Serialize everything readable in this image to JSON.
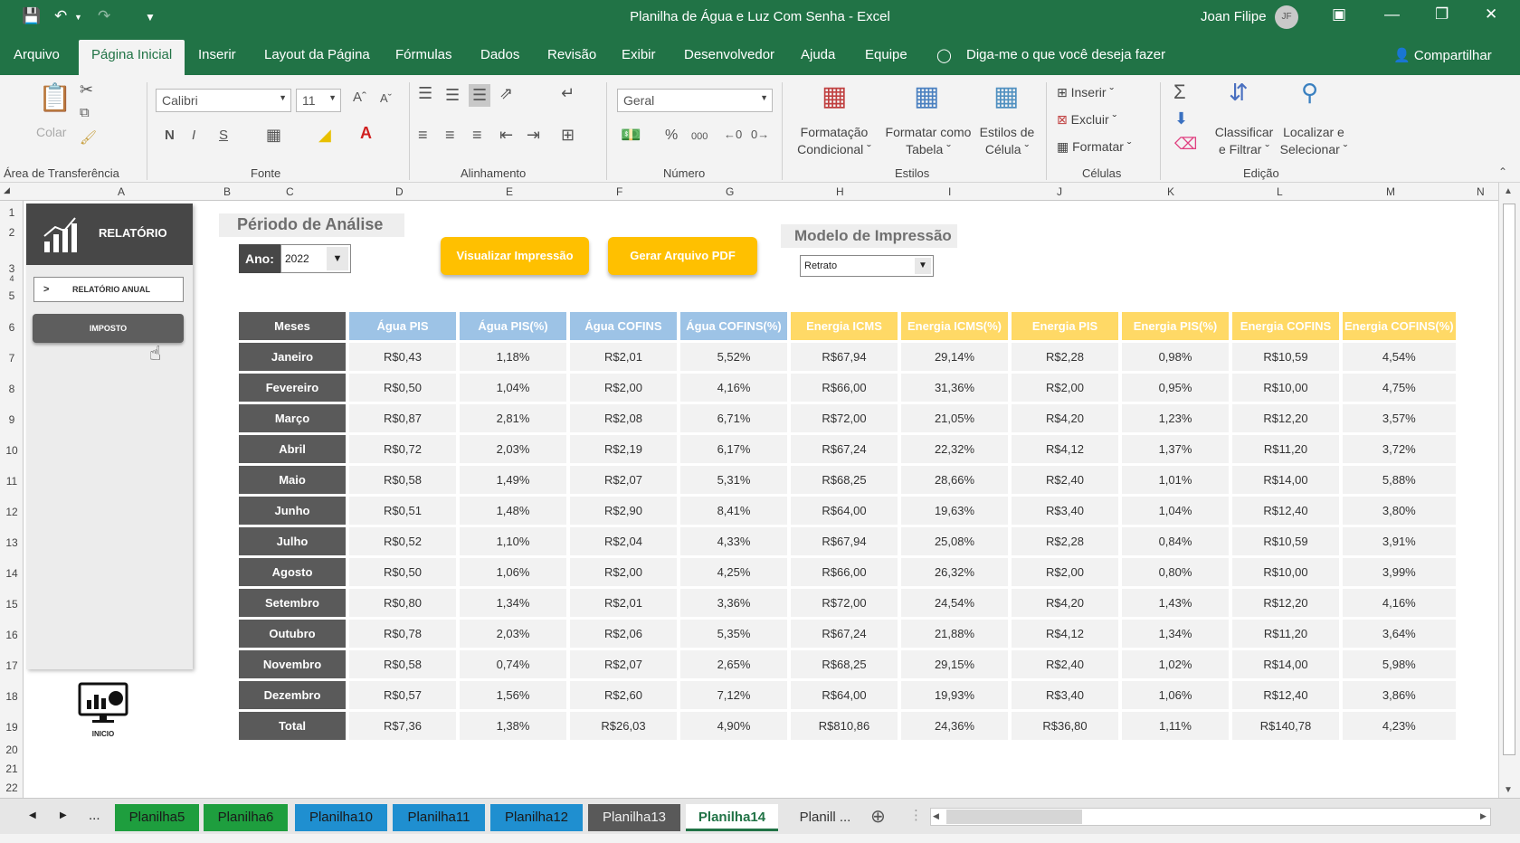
{
  "window": {
    "title": "Planilha de Água e Luz Com Senha  -  Excel",
    "user": "Joan Filipe",
    "user_initials": "JF"
  },
  "ribbon_tabs": [
    "Arquivo",
    "Página Inicial",
    "Inserir",
    "Layout da Página",
    "Fórmulas",
    "Dados",
    "Revisão",
    "Exibir",
    "Desenvolvedor",
    "Ajuda",
    "Equipe"
  ],
  "tell_me": "Diga-me o que você deseja fazer",
  "share": "Compartilhar",
  "ribbon": {
    "paste": "Colar",
    "font_name": "Calibri",
    "font_size": "11",
    "number_format": "Geral",
    "bold": "N",
    "italic": "I",
    "underline": "S",
    "groups": {
      "clipboard": "Área de Transferência",
      "font": "Fonte",
      "alignment": "Alinhamento",
      "number": "Número",
      "styles": "Estilos",
      "cells": "Células",
      "editing": "Edição"
    },
    "conditional_format": "Formatação",
    "conditional_format_2": "Condicional",
    "format_table": "Formatar como",
    "format_table_2": "Tabela",
    "cell_styles": "Estilos de",
    "cell_styles_2": "Célula",
    "insert": "Inserir",
    "delete": "Excluir",
    "format": "Formatar",
    "sort_filter": "Classificar",
    "sort_filter_2": "e Filtrar",
    "find_select": "Localizar e",
    "find_select_2": "Selecionar",
    "percent": "%",
    "thousands": "000"
  },
  "columns": [
    "A",
    "B",
    "C",
    "D",
    "E",
    "F",
    "G",
    "H",
    "I",
    "J",
    "K",
    "L",
    "M",
    "N"
  ],
  "rows": [
    "1",
    "2",
    "3",
    "4",
    "5",
    "6",
    "7",
    "8",
    "9",
    "10",
    "11",
    "12",
    "13",
    "14",
    "15",
    "16",
    "17",
    "18",
    "19",
    "20",
    "21",
    "22"
  ],
  "nav": {
    "header": "RELATÓRIO",
    "btn_annual": "RELATÓRIO ANUAL",
    "btn_annual_prefix": ">",
    "btn_tax": "IMPOSTO",
    "home": "INICIO"
  },
  "period": {
    "title": "Périodo de Análise",
    "year_label": "Ano:",
    "year_value": "2022"
  },
  "buttons": {
    "preview": "Visualizar Impressão",
    "pdf": "Gerar Arquivo PDF"
  },
  "print_model": {
    "title": "Modelo de Impressão",
    "value": "Retrato"
  },
  "table": {
    "month_header": "Meses",
    "agua_headers": [
      "Água PIS",
      "Água PIS(%)",
      "Água COFINS",
      "Água COFINS(%)"
    ],
    "energia_headers": [
      "Energia ICMS",
      "Energia ICMS(%)",
      "Energia PIS",
      "Energia PIS(%)",
      "Energia COFINS",
      "Energia COFINS(%)"
    ],
    "rows": [
      {
        "month": "Janeiro",
        "values": [
          "R$0,43",
          "1,18%",
          "R$2,01",
          "5,52%",
          "R$67,94",
          "29,14%",
          "R$2,28",
          "0,98%",
          "R$10,59",
          "4,54%"
        ]
      },
      {
        "month": "Fevereiro",
        "values": [
          "R$0,50",
          "1,04%",
          "R$2,00",
          "4,16%",
          "R$66,00",
          "31,36%",
          "R$2,00",
          "0,95%",
          "R$10,00",
          "4,75%"
        ]
      },
      {
        "month": "Março",
        "values": [
          "R$0,87",
          "2,81%",
          "R$2,08",
          "6,71%",
          "R$72,00",
          "21,05%",
          "R$4,20",
          "1,23%",
          "R$12,20",
          "3,57%"
        ]
      },
      {
        "month": "Abril",
        "values": [
          "R$0,72",
          "2,03%",
          "R$2,19",
          "6,17%",
          "R$67,24",
          "22,32%",
          "R$4,12",
          "1,37%",
          "R$11,20",
          "3,72%"
        ]
      },
      {
        "month": "Maio",
        "values": [
          "R$0,58",
          "1,49%",
          "R$2,07",
          "5,31%",
          "R$68,25",
          "28,66%",
          "R$2,40",
          "1,01%",
          "R$14,00",
          "5,88%"
        ]
      },
      {
        "month": "Junho",
        "values": [
          "R$0,51",
          "1,48%",
          "R$2,90",
          "8,41%",
          "R$64,00",
          "19,63%",
          "R$3,40",
          "1,04%",
          "R$12,40",
          "3,80%"
        ]
      },
      {
        "month": "Julho",
        "values": [
          "R$0,52",
          "1,10%",
          "R$2,04",
          "4,33%",
          "R$67,94",
          "25,08%",
          "R$2,28",
          "0,84%",
          "R$10,59",
          "3,91%"
        ]
      },
      {
        "month": "Agosto",
        "values": [
          "R$0,50",
          "1,06%",
          "R$2,00",
          "4,25%",
          "R$66,00",
          "26,32%",
          "R$2,00",
          "0,80%",
          "R$10,00",
          "3,99%"
        ]
      },
      {
        "month": "Setembro",
        "values": [
          "R$0,80",
          "1,34%",
          "R$2,01",
          "3,36%",
          "R$72,00",
          "24,54%",
          "R$4,20",
          "1,43%",
          "R$12,20",
          "4,16%"
        ]
      },
      {
        "month": "Outubro",
        "values": [
          "R$0,78",
          "2,03%",
          "R$2,06",
          "5,35%",
          "R$67,24",
          "21,88%",
          "R$4,12",
          "1,34%",
          "R$11,20",
          "3,64%"
        ]
      },
      {
        "month": "Novembro",
        "values": [
          "R$0,58",
          "0,74%",
          "R$2,07",
          "2,65%",
          "R$68,25",
          "29,15%",
          "R$2,40",
          "1,02%",
          "R$14,00",
          "5,98%"
        ]
      },
      {
        "month": "Dezembro",
        "values": [
          "R$0,57",
          "1,56%",
          "R$2,60",
          "7,12%",
          "R$64,00",
          "19,93%",
          "R$3,40",
          "1,06%",
          "R$12,40",
          "3,86%"
        ]
      },
      {
        "month": "Total",
        "values": [
          "R$7,36",
          "1,38%",
          "R$26,03",
          "4,90%",
          "R$810,86",
          "24,36%",
          "R$36,80",
          "1,11%",
          "R$140,78",
          "4,23%"
        ]
      }
    ]
  },
  "sheet_tabs": [
    {
      "name": "Planilha5",
      "color": "#1e9e3e"
    },
    {
      "name": "Planilha6",
      "color": "#1e9e3e"
    },
    {
      "name": "Planilha10",
      "color": "#1f8fd0"
    },
    {
      "name": "Planilha11",
      "color": "#1f8fd0"
    },
    {
      "name": "Planilha12",
      "color": "#1f8fd0"
    },
    {
      "name": "Planilha13",
      "color": "#595959"
    },
    {
      "name": "Planilha14",
      "color": "#ffffff"
    },
    {
      "name": "Planill ...",
      "color": "#e6e6e6"
    }
  ],
  "sheet_nav_more": "...",
  "colors": {
    "excel_green": "#217346",
    "agua_header": "#9dc3e6",
    "energia_header": "#ffd966",
    "orange_button": "#ffc000",
    "dark_gray": "#5a5a5a"
  }
}
